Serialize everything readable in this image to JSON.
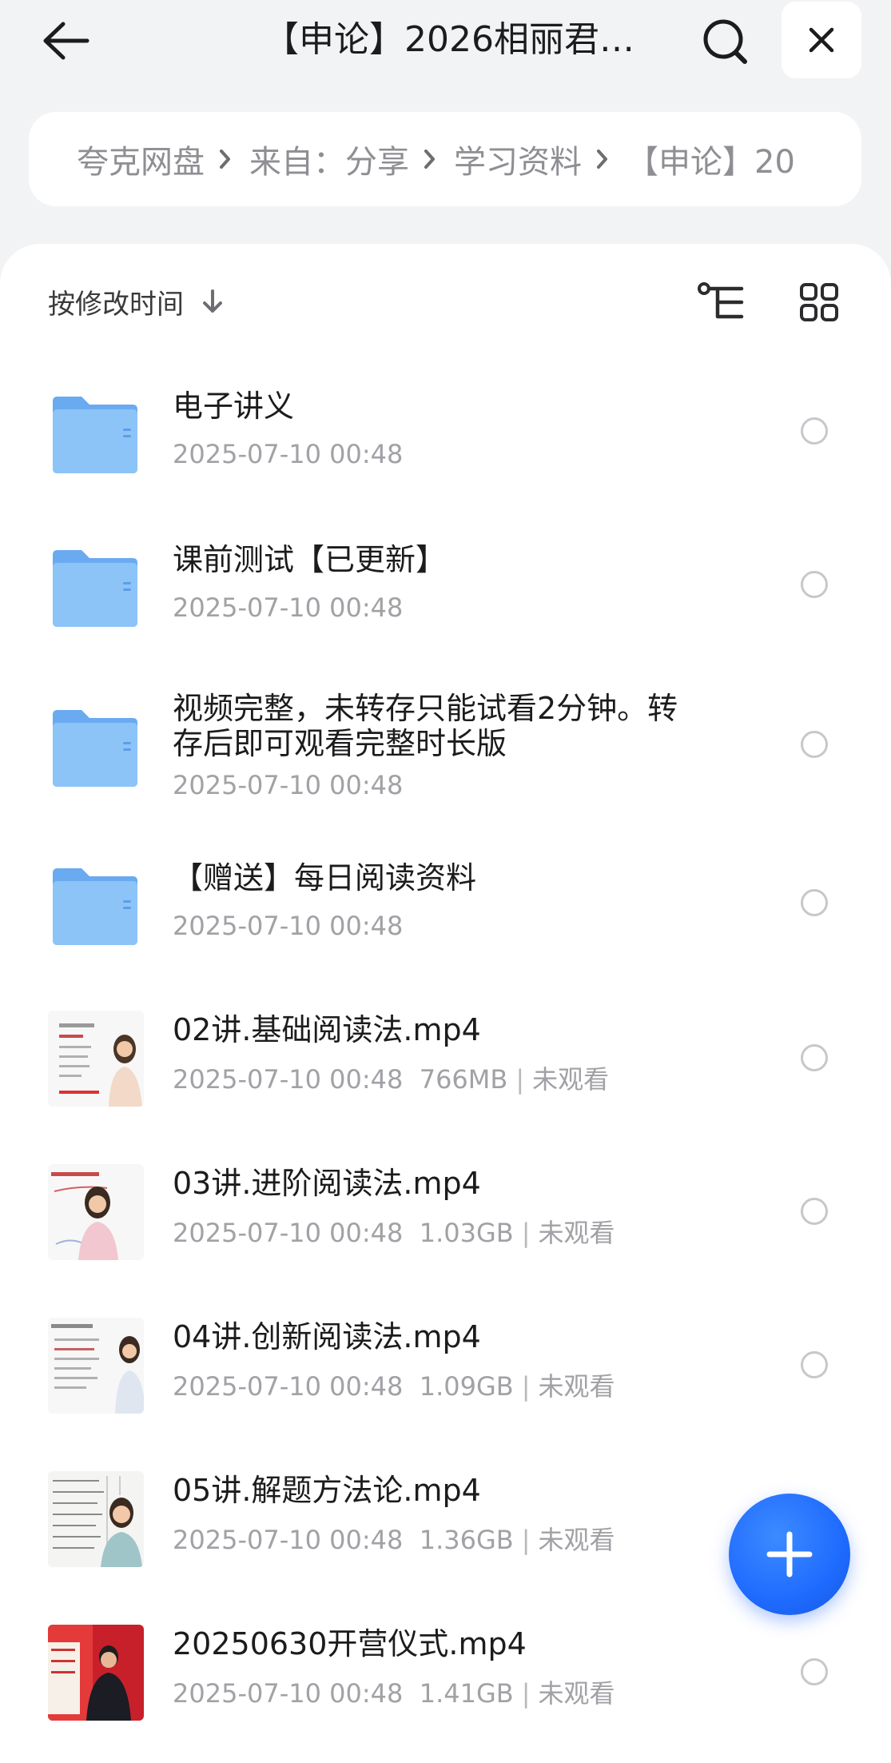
{
  "header": {
    "title": "【申论】2026相丽君…",
    "back_icon": "arrow-left-icon",
    "search_icon": "search-icon",
    "close_icon": "close-icon"
  },
  "breadcrumb": {
    "items": [
      "夸克网盘",
      "来自：分享",
      "学习资料",
      "【申论】20"
    ]
  },
  "sort": {
    "label": "按修改时间",
    "direction_icon": "arrow-down-icon"
  },
  "view_icons": [
    "tree-view-icon",
    "grid-view-icon"
  ],
  "files": [
    {
      "type": "folder",
      "name": "电子讲义",
      "date": "2025-07-10 00:48",
      "size": "",
      "status": ""
    },
    {
      "type": "folder",
      "name": "课前测试【已更新】",
      "date": "2025-07-10 00:48",
      "size": "",
      "status": ""
    },
    {
      "type": "folder",
      "name": "视频完整，未转存只能试看2分钟。转存后即可观看完整时长版",
      "date": "2025-07-10 00:48",
      "size": "",
      "status": ""
    },
    {
      "type": "folder",
      "name": "【赠送】每日阅读资料",
      "date": "2025-07-10 00:48",
      "size": "",
      "status": ""
    },
    {
      "type": "video",
      "name": "02讲.基础阅读法.mp4",
      "date": "2025-07-10 00:48",
      "size": "766MB",
      "status": "未观看"
    },
    {
      "type": "video",
      "name": "03讲.进阶阅读法.mp4",
      "date": "2025-07-10 00:48",
      "size": "1.03GB",
      "status": "未观看"
    },
    {
      "type": "video",
      "name": "04讲.创新阅读法.mp4",
      "date": "2025-07-10 00:48",
      "size": "1.09GB",
      "status": "未观看"
    },
    {
      "type": "video",
      "name": "05讲.解题方法论.mp4",
      "date": "2025-07-10 00:48",
      "size": "1.36GB",
      "status": "未观看"
    },
    {
      "type": "video",
      "name": "20250630开营仪式.mp4",
      "date": "2025-07-10 00:48",
      "size": "1.41GB",
      "status": "未观看"
    }
  ],
  "fab": {
    "icon": "plus-icon"
  },
  "colors": {
    "accent": "#1f6bff",
    "folder": "#7ab8f5",
    "text_primary": "#1c1c1e",
    "text_secondary": "#a1a1a6"
  }
}
